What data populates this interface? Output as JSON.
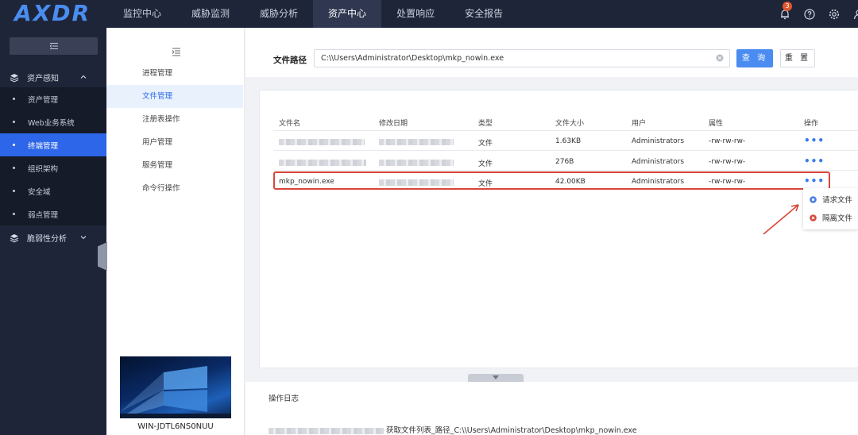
{
  "header": {
    "logo": "AXDR",
    "nav": [
      "监控中心",
      "威胁监测",
      "威胁分析",
      "资产中心",
      "处置响应",
      "安全报告"
    ],
    "active_nav": "资产中心",
    "notification_count": "3"
  },
  "sidebar": {
    "group_asset": "资产感知",
    "items": [
      "资产管理",
      "Web业务系统",
      "终端管理",
      "组织架构",
      "安全域",
      "弱点管理"
    ],
    "active_item": "终端管理",
    "group_vuln": "脆弱性分析"
  },
  "panel2": {
    "items": [
      "进程管理",
      "文件管理",
      "注册表操作",
      "用户管理",
      "服务管理",
      "命令行操作"
    ],
    "active_item": "文件管理",
    "host_name": "WIN-JDTL6NS0NUU"
  },
  "search": {
    "label": "文件路径",
    "value": "C:\\\\Users\\Administrator\\Desktop\\mkp_nowin.exe",
    "query_label": "查 询",
    "reset_label": "重 置"
  },
  "table": {
    "headers": [
      "文件名",
      "修改日期",
      "类型",
      "文件大小",
      "用户",
      "属性",
      "操作"
    ],
    "rows": [
      {
        "name": "",
        "date": "",
        "type": "文件",
        "size": "1.63KB",
        "user": "Administrators",
        "attr": "-rw-rw-rw-"
      },
      {
        "name": "",
        "date": "",
        "type": "文件",
        "size": "276B",
        "user": "Administrators",
        "attr": "-rw-rw-rw-"
      },
      {
        "name": "mkp_nowin.exe",
        "date": "",
        "type": "文件",
        "size": "42.00KB",
        "user": "Administrators",
        "attr": "-rw-rw-rw-"
      }
    ],
    "more_label": "•••"
  },
  "dropdown": {
    "request_file": "请求文件",
    "isolate_file": "隔离文件"
  },
  "log": {
    "title": "操作日志",
    "line": "获取文件列表_路径_C:\\\\Users\\Administrator\\Desktop\\mkp_nowin.exe"
  },
  "colors": {
    "primary": "#2d66e8",
    "dark_bg": "#1e2538",
    "highlight_red": "#d9463a"
  }
}
